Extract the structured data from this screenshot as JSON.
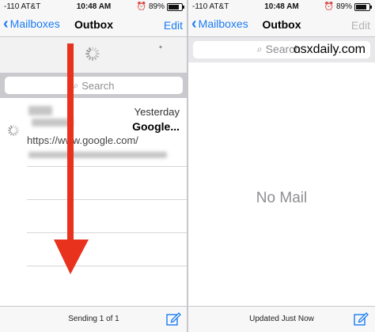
{
  "status_bar": {
    "left_carrier": "-110 AT&T",
    "left_time": "10:48 AM",
    "left_battery": "89%",
    "right_carrier": "-110 AT&T",
    "right_time": "10:48 AM",
    "right_battery": "89%"
  },
  "left_nav": {
    "back_label": "Mailboxes",
    "title": "Outbox",
    "edit_label": "Edit"
  },
  "left_search": {
    "placeholder": "Search"
  },
  "message": {
    "date": "Yesterday",
    "subject": "Google...",
    "preview": "https://www.google.com/"
  },
  "left_toolbar": {
    "status": "Sending 1 of 1"
  },
  "right_nav": {
    "back_label": "Mailboxes",
    "title": "Outbox",
    "edit_label": "Edit"
  },
  "right_search": {
    "placeholder": "Search",
    "watermark": "osxdaily.com"
  },
  "right_main": {
    "empty_text": "No Mail"
  },
  "right_toolbar": {
    "status": "Updated Just Now"
  },
  "colors": {
    "accent": "#1a7cf5",
    "arrow": "#e8321e"
  }
}
